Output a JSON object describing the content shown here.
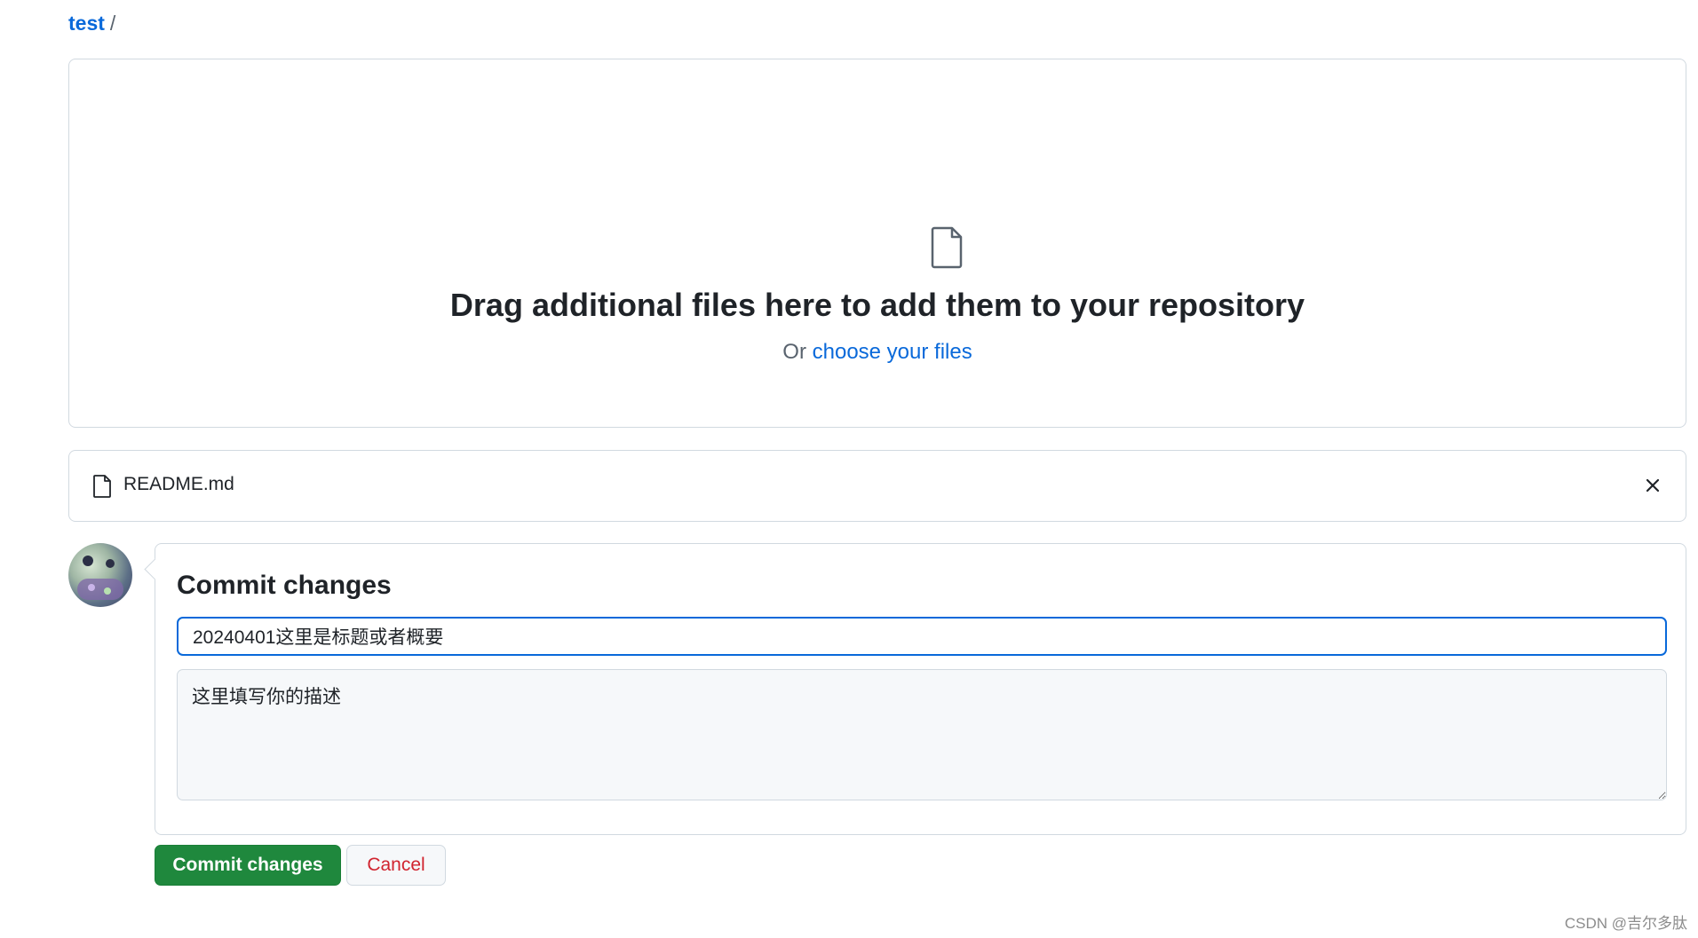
{
  "breadcrumb": {
    "repo": "test",
    "separator": "/"
  },
  "dropzone": {
    "icon": "file-icon",
    "title": "Drag additional files here to add them to your repository",
    "sub_prefix": "Or",
    "sub_link": "choose your files"
  },
  "file": {
    "icon": "file-icon",
    "name": "README.md",
    "remove_icon": "x-icon"
  },
  "commit": {
    "title": "Commit changes",
    "summary_value": "20240401这里是标题或者概要",
    "description_value": "这里填写你的描述"
  },
  "buttons": {
    "commit_label": "Commit changes",
    "cancel_label": "Cancel"
  },
  "watermark": "CSDN @吉尔多肽",
  "colors": {
    "link": "#0969da",
    "primary": "#1f883d",
    "danger": "#d1242f",
    "border": "#d1d9e0"
  }
}
